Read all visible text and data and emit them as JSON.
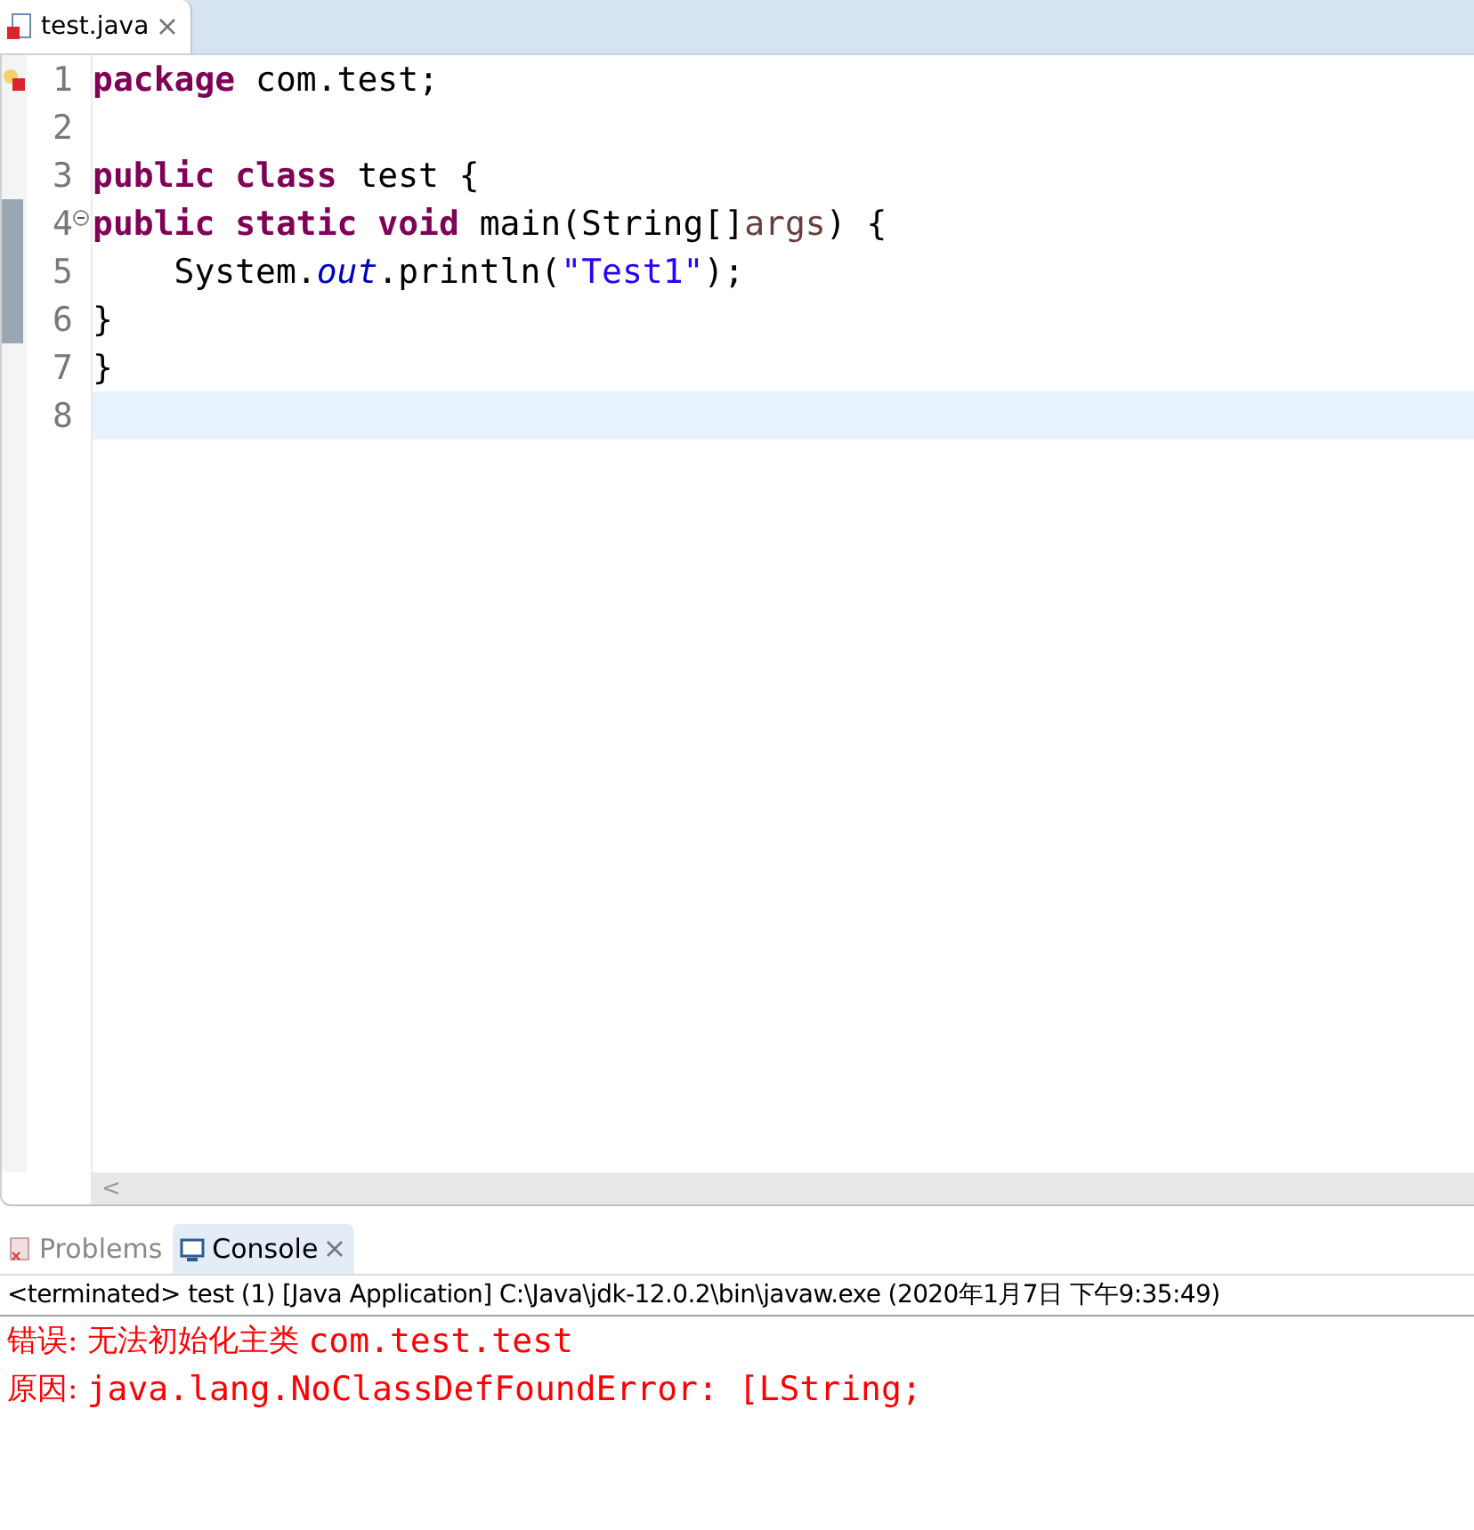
{
  "editor": {
    "tab": {
      "label": "test.java",
      "selected": true
    },
    "lines": [
      {
        "number": "1",
        "error": true,
        "tokens": [
          {
            "kind": "keyword",
            "text": "package"
          },
          {
            "kind": "plain",
            "text": " com.test;"
          }
        ]
      },
      {
        "number": "2"
      },
      {
        "number": "3",
        "tokens": [
          {
            "kind": "keyword",
            "text": "public class"
          },
          {
            "kind": "plain",
            "text": " test {"
          }
        ]
      },
      {
        "number": "4",
        "folding": true,
        "tokens": [
          {
            "kind": "keyword",
            "text": "public static void"
          },
          {
            "kind": "plain",
            "text": " main(String[]"
          },
          {
            "kind": "param",
            "text": "args"
          },
          {
            "kind": "plain",
            "text": ") {"
          }
        ]
      },
      {
        "number": "5",
        "tokens": [
          {
            "kind": "plain",
            "text": "    System."
          },
          {
            "kind": "field",
            "text": "out"
          },
          {
            "kind": "plain",
            "text": ".println("
          },
          {
            "kind": "string",
            "text": "\"Test1\""
          },
          {
            "kind": "plain",
            "text": ");"
          }
        ]
      },
      {
        "number": "6",
        "tokens": [
          {
            "kind": "plain",
            "text": "}"
          }
        ]
      },
      {
        "number": "7",
        "tokens": [
          {
            "kind": "plain",
            "text": "}"
          }
        ]
      },
      {
        "number": "8",
        "current": true
      }
    ],
    "scroll_arrow": "<"
  },
  "panel": {
    "tabs": [
      {
        "label": "Problems",
        "selected": false,
        "kind": "problems"
      },
      {
        "label": "Console",
        "selected": true,
        "kind": "console"
      }
    ],
    "status": "<terminated> test (1) [Java Application] C:\\Java\\jdk-12.0.2\\bin\\javaw.exe (2020年1月7日 下午9:35:49)",
    "output": [
      {
        "prefix": "错误: 无法初始化主类",
        "message": "com.test.test"
      },
      {
        "prefix": "原因:",
        "message": "java.lang.NoClassDefFoundError: [LString;"
      }
    ]
  }
}
